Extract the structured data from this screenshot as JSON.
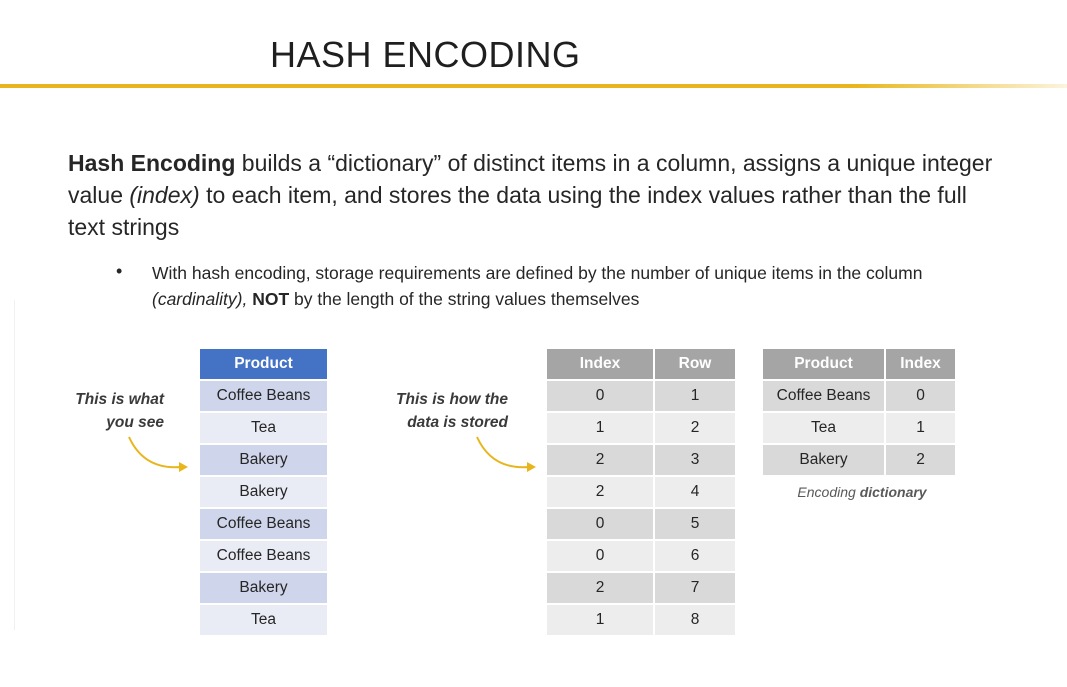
{
  "slide": {
    "title": "HASH ENCODING",
    "intro": {
      "term": "Hash Encoding",
      "text_1": " builds a “dictionary” of distinct items in a column, assigns a unique integer value ",
      "index_term": "(index)",
      "text_2": " to each item, and stores the data using the index values rather than the full text strings"
    },
    "bullet": {
      "marker": "•",
      "text_1": "With hash encoding, storage requirements are defined by the number of unique items in the column ",
      "cardinality": "(cardinality),",
      "not": "NOT",
      "text_2": " by the length of the string values themselves"
    },
    "notes": {
      "what_you_see": "This is what you see",
      "how_stored": "This is how the data is stored"
    },
    "product_table": {
      "header": "Product",
      "rows": [
        "Coffee Beans",
        "Tea",
        "Bakery",
        "Bakery",
        "Coffee Beans",
        "Coffee Beans",
        "Bakery",
        "Tea"
      ]
    },
    "index_table": {
      "headers": [
        "Index",
        "Row"
      ],
      "rows": [
        [
          "0",
          "1"
        ],
        [
          "1",
          "2"
        ],
        [
          "2",
          "3"
        ],
        [
          "2",
          "4"
        ],
        [
          "0",
          "5"
        ],
        [
          "0",
          "6"
        ],
        [
          "2",
          "7"
        ],
        [
          "1",
          "8"
        ]
      ]
    },
    "dictionary_table": {
      "headers": [
        "Product",
        "Index"
      ],
      "rows": [
        [
          "Coffee Beans",
          "0"
        ],
        [
          "Tea",
          "1"
        ],
        [
          "Bakery",
          "2"
        ]
      ],
      "caption_1": "Encoding ",
      "caption_2": "dictionary"
    },
    "colors": {
      "accent_rule": "#e8b61c",
      "arrow": "#e8b61c",
      "product_header": "#4472c4",
      "product_band_dark": "#cfd5ea",
      "product_band_light": "#e9ebf5",
      "gray_header": "#a5a5a5",
      "gray_band_dark": "#d9d9d9",
      "gray_band_light": "#ededed"
    }
  }
}
